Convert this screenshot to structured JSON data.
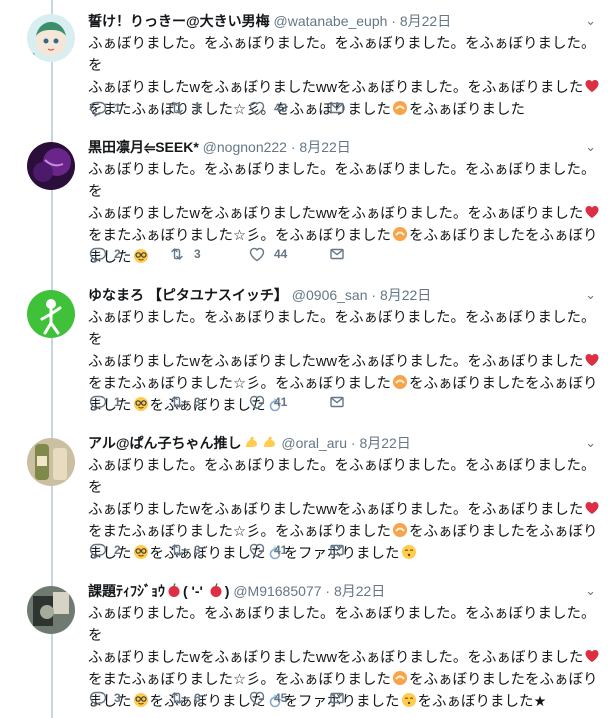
{
  "tweets": [
    {
      "name": "誓け！りっきー@大きい男梅",
      "handle": "@watanabe_euph",
      "date": "8月22日",
      "lines": [
        "ふぁぼりました。をふぁぼりました。をふぁぼりました。をふぁぼりました。を",
        "ふぁぼりましたwをふぁぼりましたwwをふぁぼりました。をふぁぼりました",
        "をまたふぁぼりました☆彡。をふぁぼりました",
        "をふぁぼりました"
      ],
      "replies": "1",
      "retweets": "3",
      "likes": "43"
    },
    {
      "name": "黒田凛月⥢SEEK*",
      "handle": "@nognon222",
      "date": "8月22日",
      "lines": [
        "ふぁぼりました。をふぁぼりました。をふぁぼりました。をふぁぼりました。を",
        "ふぁぼりましたwをふぁぼりましたwwをふぁぼりました。をふぁぼりました",
        "をまたふぁぼりました☆彡。をふぁぼりました",
        "をふぁぼりましたをふぁぼり",
        "ました"
      ],
      "replies": "2",
      "retweets": "3",
      "likes": "44"
    },
    {
      "name": "ゆなまろ 【ピタユナスイッチ】",
      "handle": "@0906_san",
      "date": "8月22日",
      "lines": [
        "ふぁぼりました。をふぁぼりました。をふぁぼりました。をふぁぼりました。を",
        "ふぁぼりましたwをふぁぼりましたwwをふぁぼりました。をふぁぼりました",
        "をまたふぁぼりました☆彡。をふぁぼりました",
        "をふぁぼりましたをふぁぼり",
        "ました",
        "をふぁぼりました"
      ],
      "replies": "1",
      "retweets": "3",
      "likes": "41"
    },
    {
      "name": "アル@ぱん子ちゃん推し",
      "handle": "@oral_aru",
      "date": "8月22日",
      "lines": [
        "ふぁぼりました。をふぁぼりました。をふぁぼりました。をふぁぼりました。を",
        "ふぁぼりましたwをふぁぼりましたwwをふぁぼりました。をふぁぼりました",
        "をまたふぁぼりました☆彡。をふぁぼりました",
        "をふぁぼりましたをふぁぼり",
        "ました",
        "をふぁぼりました",
        "をファボりました"
      ],
      "replies": "2",
      "retweets": "3",
      "likes": "41"
    },
    {
      "name": "課題ﾃｨﾌｼﾞｮｳ",
      "name_tail": "( '-' ",
      "handle": "@M91685077",
      "date": "8月22日",
      "lines": [
        "ふぁぼりました。をふぁぼりました。をふぁぼりました。をふぁぼりました。を",
        "ふぁぼりましたwをふぁぼりましたwwをふぁぼりました。をふぁぼりました",
        "をまたふぁぼりました☆彡。をふぁぼりました",
        "をふぁぼりましたをふぁぼり",
        "ました",
        "をふぁぼりました",
        "をファボりました",
        "をふぁぼりました★"
      ],
      "replies": "3",
      "retweets": "6",
      "likes": "45"
    }
  ],
  "separator": "·",
  "colors": {
    "text": "#14171a",
    "muted": "#657786",
    "thread": "#c4d7e6",
    "heart": "#e0245e"
  }
}
